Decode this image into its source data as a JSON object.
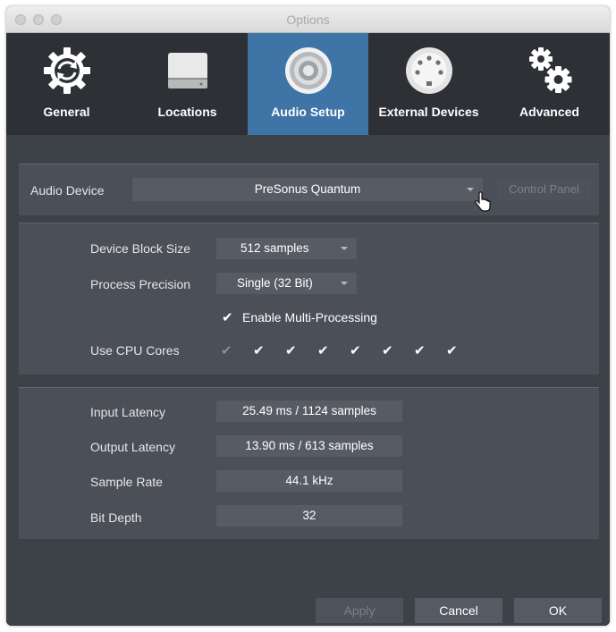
{
  "window": {
    "title": "Options"
  },
  "tabs": [
    {
      "label": "General",
      "icon": "gear-refresh-icon",
      "active": false
    },
    {
      "label": "Locations",
      "icon": "drive-icon",
      "active": false
    },
    {
      "label": "Audio Setup",
      "icon": "speaker-icon",
      "active": true
    },
    {
      "label": "External Devices",
      "icon": "midi-connector-icon",
      "active": false
    },
    {
      "label": "Advanced",
      "icon": "gears-icon",
      "active": false
    }
  ],
  "audio_device": {
    "label": "Audio Device",
    "value": "PreSonus Quantum",
    "control_panel_label": "Control Panel"
  },
  "processing": {
    "block_size_label": "Device Block Size",
    "block_size_value": "512 samples",
    "precision_label": "Process Precision",
    "precision_value": "Single (32 Bit)",
    "multi_processing_label": "Enable Multi-Processing",
    "multi_processing_checked": true,
    "cpu_cores_label": "Use CPU Cores",
    "cpu_cores": [
      true,
      true,
      true,
      true,
      true,
      true,
      true,
      true
    ]
  },
  "info": {
    "input_latency_label": "Input Latency",
    "input_latency_value": "25.49 ms / 1124 samples",
    "output_latency_label": "Output Latency",
    "output_latency_value": "13.90 ms / 613 samples",
    "sample_rate_label": "Sample Rate",
    "sample_rate_value": "44.1 kHz",
    "bit_depth_label": "Bit Depth",
    "bit_depth_value": "32"
  },
  "buttons": {
    "apply": "Apply",
    "cancel": "Cancel",
    "ok": "OK"
  },
  "colors": {
    "accent": "#3f74a6",
    "toolbar": "#2d3035",
    "panel": "#4b4f57",
    "window": "#3d4148"
  }
}
